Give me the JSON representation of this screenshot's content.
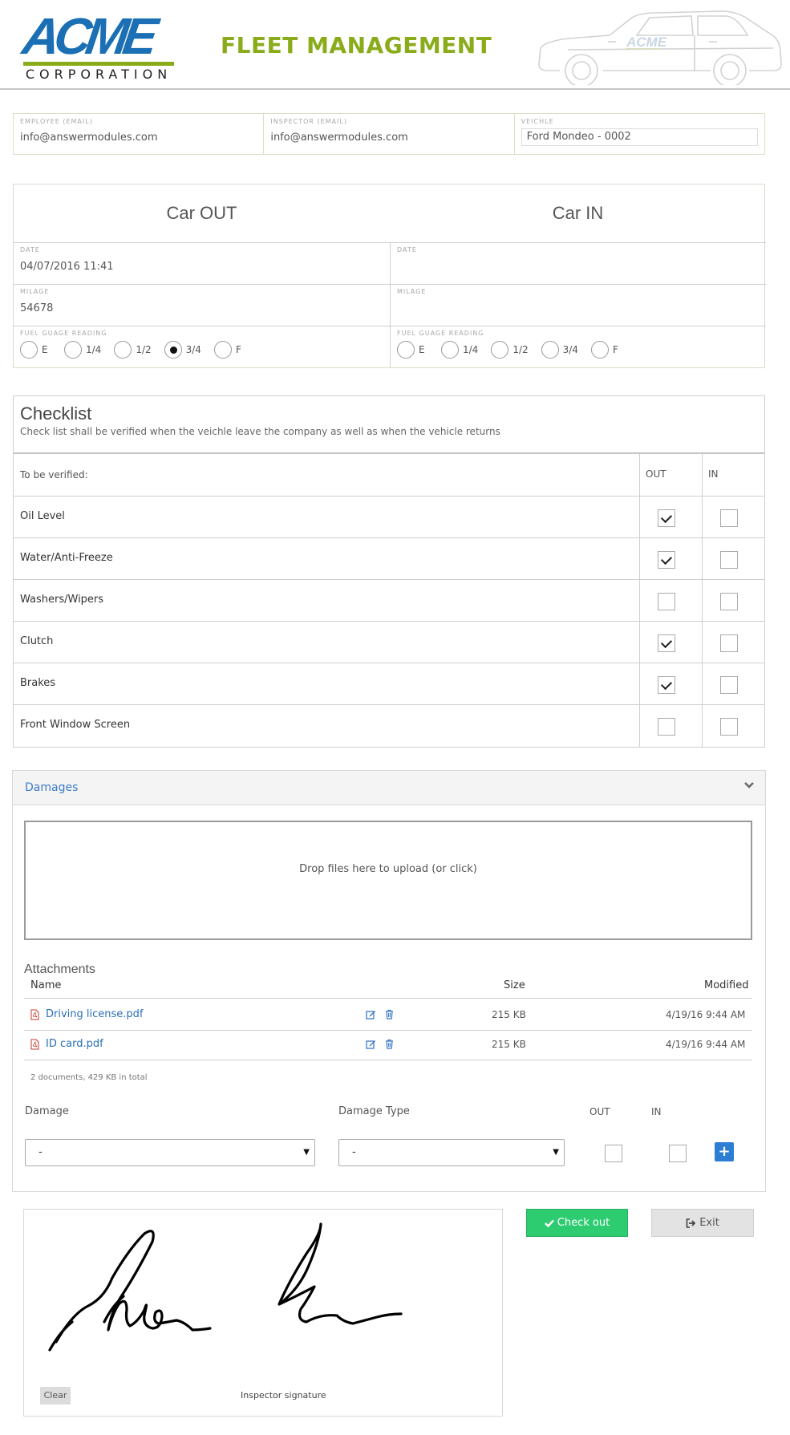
{
  "header": {
    "logo_main": "ACME",
    "logo_sub": "CORPORATION",
    "logo_small": "ACME",
    "title": "FLEET MANAGEMENT"
  },
  "info": {
    "employee_label": "EMPLOYEE (EMAIL)",
    "employee_value": "info@answermodules.com",
    "inspector_label": "INSPECTOR (EMAIL)",
    "inspector_value": "info@answermodules.com",
    "vehicle_label": "VEICHLE",
    "vehicle_value": "Ford Mondeo - 0002"
  },
  "car": {
    "out_title": "Car OUT",
    "in_title": "Car IN",
    "date_label": "DATE",
    "out_date": "04/07/2016 11:41",
    "in_date": "",
    "milage_label": "MILAGE",
    "out_milage": "54678",
    "in_milage": "",
    "fuel_label": "FUEL GUAGE READING",
    "fuel_options": [
      "E",
      "1/4",
      "1/2",
      "3/4",
      "F"
    ],
    "out_fuel_selected": "3/4",
    "in_fuel_selected": ""
  },
  "checklist": {
    "title": "Checklist",
    "subtitle": "Check list shall be verified when the veichle leave the company as well as when the vehicle returns",
    "col_item": "To be verified:",
    "col_out": "OUT",
    "col_in": "IN",
    "items": [
      {
        "label": "Oil Level",
        "out": true,
        "in": false
      },
      {
        "label": "Water/Anti-Freeze",
        "out": true,
        "in": false
      },
      {
        "label": "Washers/Wipers",
        "out": false,
        "in": false
      },
      {
        "label": "Clutch",
        "out": true,
        "in": false
      },
      {
        "label": "Brakes",
        "out": true,
        "in": false
      },
      {
        "label": "Front Window Screen",
        "out": false,
        "in": false
      }
    ]
  },
  "damages": {
    "title": "Damages",
    "dropzone_text": "Drop files here to upload (or click)",
    "attachments_title": "Attachments",
    "col_name": "Name",
    "col_size": "Size",
    "col_modified": "Modified",
    "files": [
      {
        "name": "Driving license.pdf",
        "size": "215 KB",
        "modified": "4/19/16 9:44 AM"
      },
      {
        "name": "ID card.pdf",
        "size": "215 KB",
        "modified": "4/19/16 9:44 AM"
      }
    ],
    "summary": "2 documents, 429 KB in total",
    "damage_label": "Damage",
    "damage_type_label": "Damage Type",
    "out_label": "OUT",
    "in_label": "IN",
    "damage_value": "-",
    "damage_type_value": "-",
    "add_symbol": "+"
  },
  "signature": {
    "clear_label": "Clear",
    "caption": "Inspector signature"
  },
  "actions": {
    "checkout_label": "Check out",
    "exit_label": "Exit"
  },
  "colors": {
    "brand_blue": "#1b6fb4",
    "brand_green": "#8aac1a",
    "checkout_green": "#2ecc71",
    "link_blue": "#2a6fb5"
  }
}
